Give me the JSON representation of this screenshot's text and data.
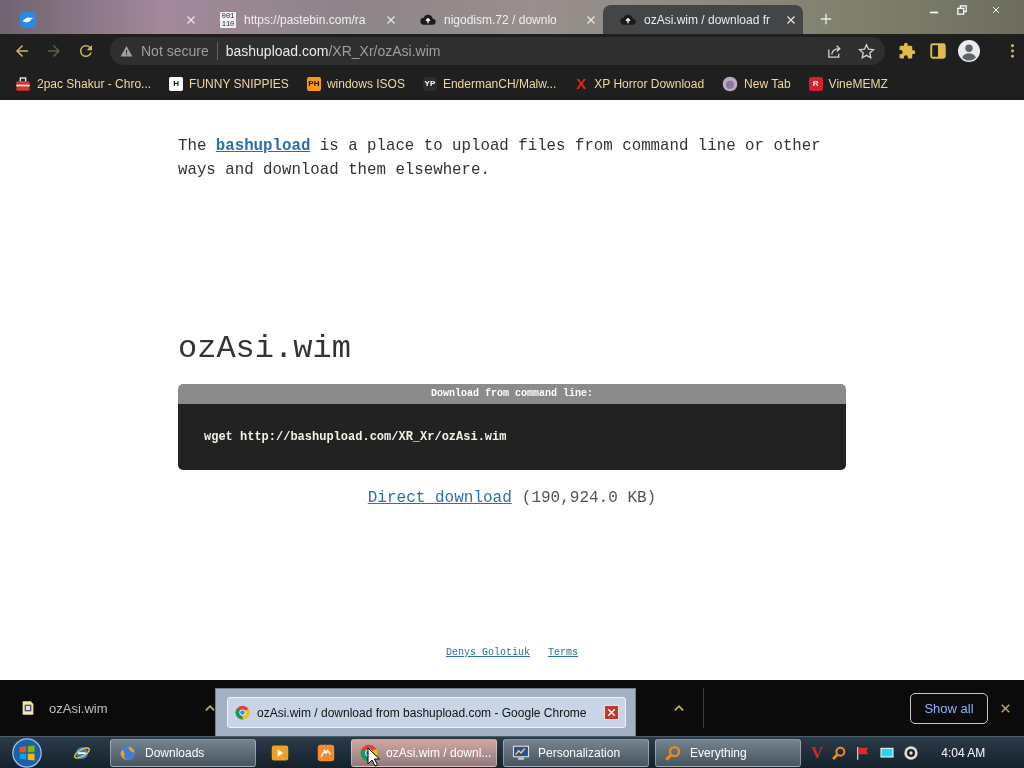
{
  "tabs": [
    {
      "icon": {
        "kind": "app"
      },
      "selected": false
    },
    {
      "icon": {
        "kind": "digits",
        "text": "001 110"
      },
      "title": "https://pastebin.com/ra",
      "selected": false
    },
    {
      "icon": {
        "kind": "cloud"
      },
      "title": "nigodism.72 / downlo",
      "selected": false
    },
    {
      "icon": {
        "kind": "cloud"
      },
      "title": "ozAsi.wim / download fr",
      "selected": true
    }
  ],
  "toolbar": {
    "back": {
      "disabled": false
    },
    "forward": {
      "disabled": true
    }
  },
  "address": {
    "security": "Not secure",
    "host": "bashupload.com",
    "path": "/XR_Xr/ozAsi.wim"
  },
  "bookmarks": [
    {
      "icon": {
        "kind": "toolbox"
      },
      "label": "2pac Shakur - Chro..."
    },
    {
      "icon": {
        "kind": "tile",
        "text": "H",
        "color": "#ffffff"
      },
      "label": "FUNNY SNIPPIES"
    },
    {
      "icon": {
        "kind": "tile",
        "text": "PH",
        "color": "#f7971d"
      },
      "label": "windows ISOS"
    },
    {
      "icon": {
        "kind": "tile",
        "text": "YP",
        "color": "#2b2b2b"
      },
      "label": "EndermanCH/Malw..."
    },
    {
      "icon": {
        "kind": "mark",
        "text": "X",
        "color": "#e3261f"
      },
      "label": "XP Horror Download"
    },
    {
      "icon": {
        "kind": "thumb"
      },
      "label": "New Tab"
    },
    {
      "icon": {
        "kind": "tile",
        "text": "R",
        "color": "#d2202f"
      },
      "label": "VineMEMZ"
    }
  ],
  "page": {
    "intro": {
      "before": "The ",
      "link": "bashupload",
      "after": " is a place to upload files from command line or other ways and download them elsewhere."
    },
    "file_name": "ozAsi.wim",
    "command": {
      "header": "Download from command line:",
      "line": "wget http://bashupload.com/XR_Xr/ozAsi.wim"
    },
    "direct": {
      "link": "Direct download",
      "size": "(190,924.0 KB)"
    },
    "footer_links": [
      "Denys Golotiuk",
      "Terms"
    ]
  },
  "download_bar": {
    "items": [
      {
        "file": "ozAsi.wim"
      }
    ],
    "show_all": "Show all"
  },
  "thumbnail_popup": {
    "title": "ozAsi.wim / download from bashupload.com - Google Chrome"
  },
  "taskbar": {
    "items": [
      {
        "kind": "start",
        "selected": false
      },
      {
        "kind": "launcher",
        "selected": false
      },
      {
        "kind": "window",
        "label": "Downloads",
        "selected": false
      },
      {
        "kind": "launcher",
        "selected": false
      },
      {
        "kind": "launcher",
        "selected": false
      },
      {
        "kind": "window",
        "label": "ozAsi.wim / downl...",
        "selected": true
      },
      {
        "kind": "window",
        "label": "Personalization",
        "selected": false
      },
      {
        "kind": "window",
        "label": "Everything",
        "selected": false
      }
    ],
    "tray": [
      {
        "kind": "letter",
        "text": "V",
        "color": "#d62828"
      },
      {
        "kind": "magnifier"
      },
      {
        "kind": "flag"
      },
      {
        "kind": "display"
      },
      {
        "kind": "speaker"
      }
    ],
    "clock": "4:04 AM"
  }
}
